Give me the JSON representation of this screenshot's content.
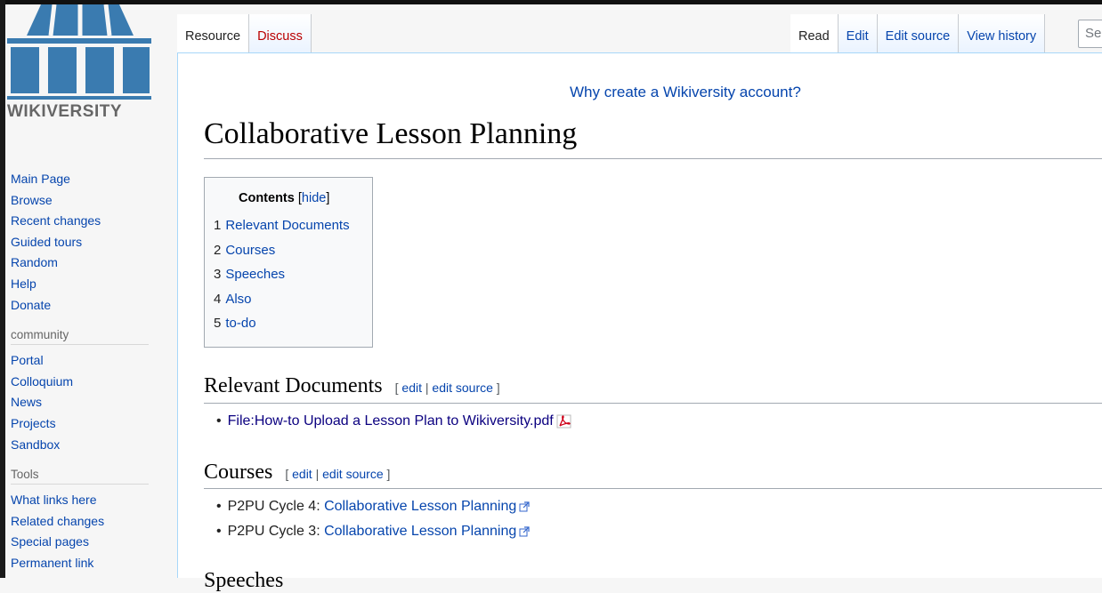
{
  "logo": {
    "text": "WIKIVERSITY"
  },
  "sidebar": {
    "nav": [
      "Main Page",
      "Browse",
      "Recent changes",
      "Guided tours",
      "Random",
      "Help",
      "Donate"
    ],
    "community_heading": "community",
    "community": [
      "Portal",
      "Colloquium",
      "News",
      "Projects",
      "Sandbox"
    ],
    "tools_heading": "Tools",
    "tools": [
      "What links here",
      "Related changes",
      "Special pages",
      "Permanent link"
    ]
  },
  "tabs": {
    "resource": "Resource",
    "discuss": "Discuss",
    "read": "Read",
    "edit": "Edit",
    "edit_source": "Edit source",
    "view_history": "View history"
  },
  "search": {
    "placeholder": "Se"
  },
  "sitenotice": "Why create a Wikiversity account?",
  "page": {
    "title": "Collaborative Lesson Planning"
  },
  "toc": {
    "title": "Contents",
    "toggle_open": "[",
    "toggle": "hide",
    "toggle_close": "]",
    "items": [
      {
        "num": "1",
        "label": "Relevant Documents"
      },
      {
        "num": "2",
        "label": "Courses"
      },
      {
        "num": "3",
        "label": "Speeches"
      },
      {
        "num": "4",
        "label": "Also"
      },
      {
        "num": "5",
        "label": "to-do"
      }
    ]
  },
  "editsection": {
    "open": "[",
    "edit": "edit",
    "sep": "|",
    "edit_source": "edit source",
    "close": "]"
  },
  "sections": {
    "relevant_documents": {
      "heading": "Relevant Documents",
      "items": [
        {
          "link": "File:How-to Upload a Lesson Plan to Wikiversity.pdf"
        }
      ]
    },
    "courses": {
      "heading": "Courses",
      "items": [
        {
          "prefix": "P2PU Cycle 4: ",
          "link": "Collaborative Lesson Planning"
        },
        {
          "prefix": "P2PU Cycle 3: ",
          "link": "Collaborative Lesson Planning"
        }
      ]
    },
    "speeches": {
      "heading": "Speeches"
    }
  },
  "colors": {
    "link": "#0645ad",
    "new_link": "#ba0000",
    "visited": "#0b0080",
    "border": "#a7d7f9"
  }
}
